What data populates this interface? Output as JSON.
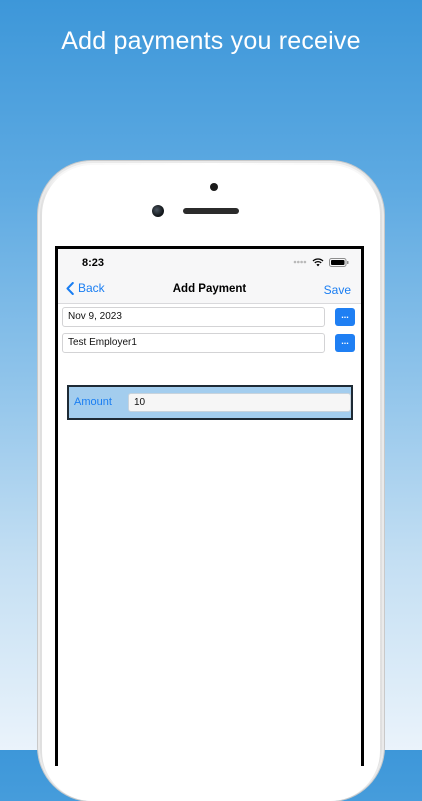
{
  "headline": "Add payments you receive",
  "status_bar": {
    "time": "8:23"
  },
  "nav": {
    "back_label": "Back",
    "title": "Add Payment",
    "save_label": "Save"
  },
  "form": {
    "date_value": "Nov 9, 2023",
    "employer_value": "Test Employer1",
    "more_button_label": "...",
    "amount_label": "Amount",
    "amount_value": "10"
  },
  "icons": {
    "back": "chevron-left-icon",
    "signal": "signal-dots-icon",
    "wifi": "wifi-icon",
    "battery": "battery-icon"
  },
  "colors": {
    "accent": "#1a7ef2",
    "amount_panel": "#a3cdee",
    "background_top": "#3d97d9"
  }
}
